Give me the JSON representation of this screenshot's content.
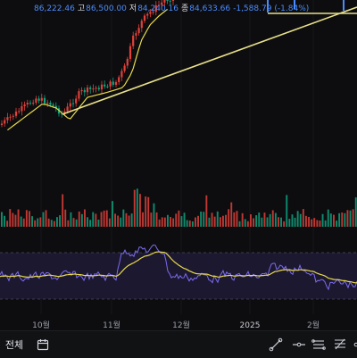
{
  "ohlc": {
    "partial_open": "86,222.46",
    "high_label": "고",
    "high_value": "86,500.00",
    "low_label": "저",
    "low_value": "84,240.16",
    "close_label": "종",
    "close_value": "84,633.66",
    "change": "-1,588.79",
    "change_pct": "(-1.84%)"
  },
  "x_axis": {
    "labels": [
      "10월",
      "11월",
      "12월",
      "2025",
      "2월"
    ]
  },
  "toolbar": {
    "period_label": "전체",
    "icons": [
      "calendar-icon",
      "trendline-tool-icon",
      "horizontal-line-tool-icon",
      "channel-tool-icon",
      "fib-tool-icon",
      "ray-tool-icon"
    ]
  },
  "colors": {
    "up": "#0fa37f",
    "down": "#e0413a",
    "ma": "#e8d94a",
    "rsi": "#7b6cf0",
    "rsi_band": "#1f1a33",
    "accent": "#4a8cff"
  }
}
